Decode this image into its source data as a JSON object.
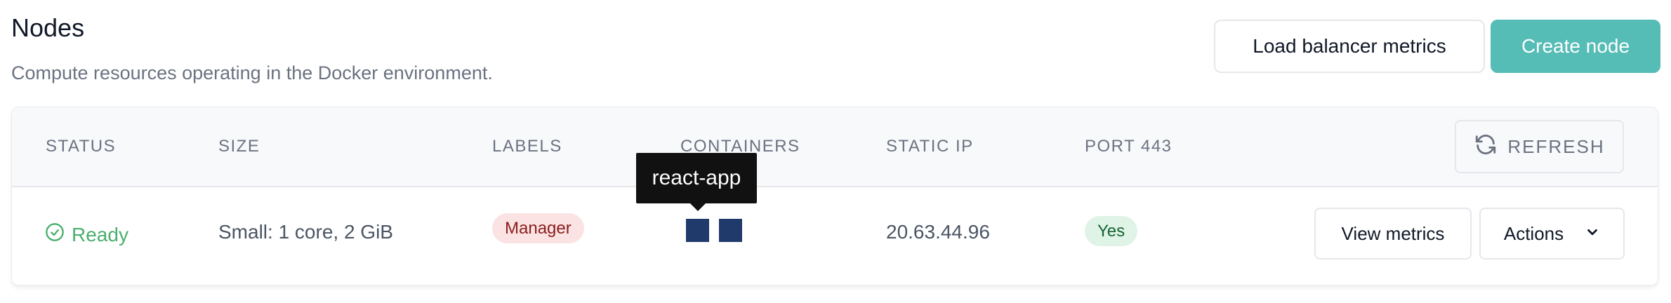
{
  "page": {
    "title": "Nodes",
    "subtitle": "Compute resources operating in the Docker environment."
  },
  "header_buttons": {
    "load_balancer": "Load balancer metrics",
    "create_node": "Create node"
  },
  "table": {
    "columns": [
      "STATUS",
      "SIZE",
      "LABELS",
      "CONTAINERS",
      "STATIC IP",
      "PORT 443"
    ],
    "refresh_label": "REFRESH",
    "rows": [
      {
        "status": "Ready",
        "size": "Small: 1 core, 2 GiB",
        "label": "Manager",
        "containers_tooltip": "react-app",
        "static_ip": "20.63.44.96",
        "port_443": "Yes",
        "view_metrics": "View metrics",
        "actions": "Actions"
      }
    ]
  },
  "colors": {
    "primary": "#56bcb6",
    "ready": "#4caf6e",
    "container": "#1f3a6b"
  },
  "icons": [
    "refresh-icon",
    "check-circle-icon",
    "chevron-down-icon"
  ]
}
